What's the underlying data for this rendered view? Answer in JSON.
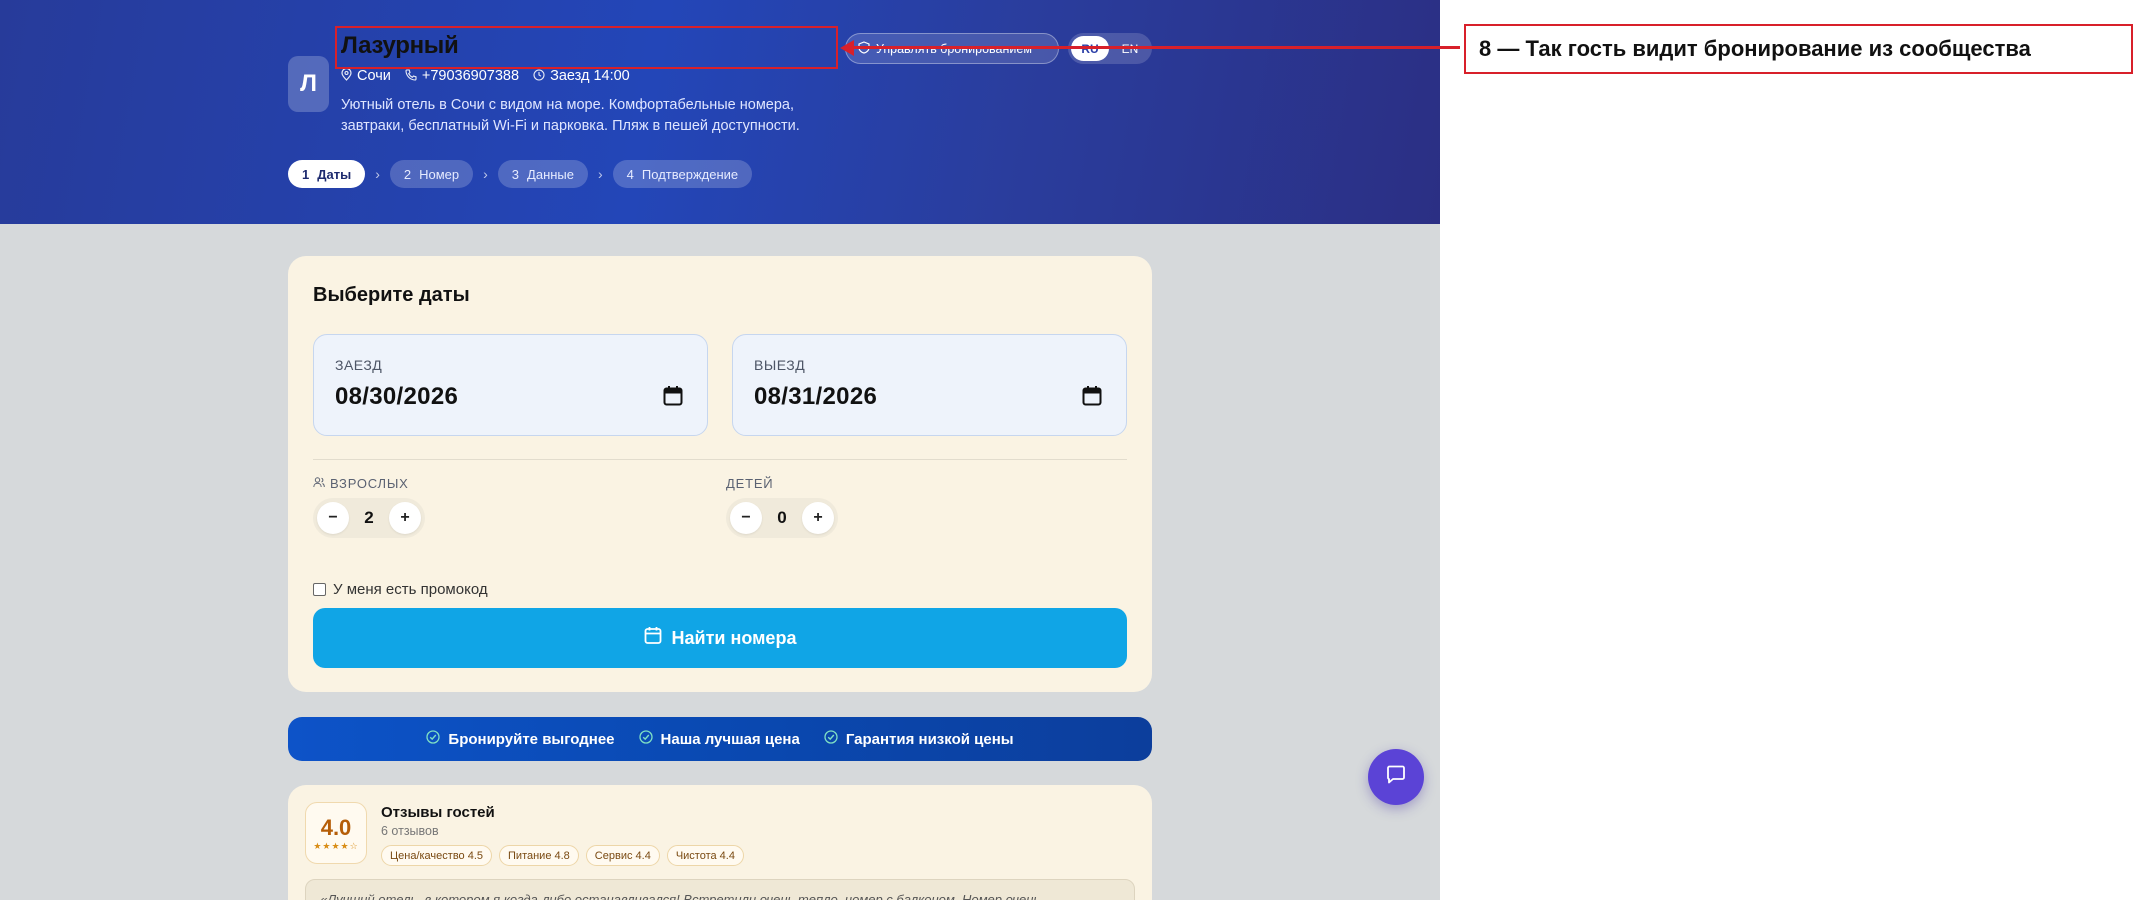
{
  "hotel": {
    "logo_letter": "Л",
    "name": "Лазурный",
    "city": "Сочи",
    "phone": "+79036907388",
    "checkin_time": "Заезд 14:00",
    "description": "Уютный отель в Сочи с видом на море. Комфортабельные номера, завтраки, бесплатный Wi-Fi и парковка. Пляж в пешей доступности."
  },
  "header": {
    "manage_label": "Управлять бронированием",
    "languages": [
      "RU",
      "EN"
    ],
    "active_language": "RU"
  },
  "steps": [
    {
      "num": "1",
      "label": "Даты",
      "active": true
    },
    {
      "num": "2",
      "label": "Номер",
      "active": false
    },
    {
      "num": "3",
      "label": "Данные",
      "active": false
    },
    {
      "num": "4",
      "label": "Подтверждение",
      "active": false
    }
  ],
  "dates": {
    "title": "Выберите даты",
    "checkin_label": "ЗАЕЗД",
    "checkin_value": "08/30/2026",
    "checkout_label": "ВЫЕЗД",
    "checkout_value": "08/31/2026"
  },
  "guests": {
    "adults_label": "ВЗРОСЛЫХ",
    "adults_value": "2",
    "children_label": "ДЕТЕЙ",
    "children_value": "0",
    "minus": "−",
    "plus": "+"
  },
  "promo_label": "У меня есть промокод",
  "search_label": "Найти номера",
  "benefits": [
    "Бронируйте выгоднее",
    "Наша лучшая цена",
    "Гарантия низкой цены"
  ],
  "reviews": {
    "score": "4.0",
    "stars": "★★★★☆",
    "title": "Отзывы гостей",
    "count": "6 отзывов",
    "tags": [
      "Цена/качество 4.5",
      "Питание 4.8",
      "Сервис 4.4",
      "Чистота 4.4"
    ],
    "quote": "«Лучший отель, в котором я когда-либо останавливался! Встретили очень тепло, номер с балконом. Номер очень"
  },
  "annotation": {
    "label": "8 — Так гость видит бронирование из сообщества",
    "color": "#d8202a"
  },
  "colors": {
    "accent": "#10a5e6",
    "brand": "#2346b8",
    "chat": "#5b43d6",
    "rating": "#b55d07"
  }
}
